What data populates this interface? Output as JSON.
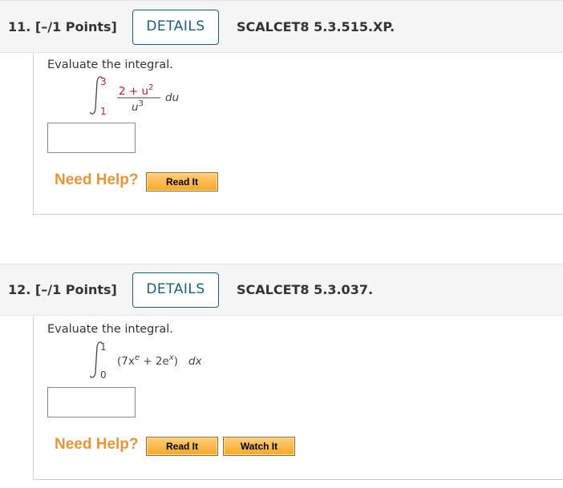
{
  "questions": [
    {
      "number": "11.",
      "points": "[–/1 Points]",
      "details_label": "DETAILS",
      "code": "SCALCET8 5.3.515.XP.",
      "prompt": "Evaluate the integral.",
      "integral": {
        "upper": "3",
        "lower": "1",
        "numerator": "2 + u",
        "numerator_exp": "2",
        "denominator": "u",
        "denominator_exp": "3",
        "differential": "du"
      },
      "answer_value": "",
      "need_help": "Need Help?",
      "help_buttons": [
        "Read It"
      ]
    },
    {
      "number": "12.",
      "points": "[–/1 Points]",
      "details_label": "DETAILS",
      "code": "SCALCET8 5.3.037.",
      "prompt": "Evaluate the integral.",
      "integral": {
        "upper": "1",
        "lower": "0",
        "integrand_open": "(7x",
        "exp1": "e",
        "middle": " + 2e",
        "exp2": "x",
        "integrand_close": ")",
        "differential": "dx"
      },
      "answer_value": "",
      "need_help": "Need Help?",
      "help_buttons": [
        "Read It",
        "Watch It"
      ]
    }
  ],
  "colors": {
    "header_bg": "#f5f5f5",
    "details_border": "#1c5d7a",
    "need_help": "#e8953a",
    "button_fill": "#f6a829",
    "math_red": "#b3242a"
  }
}
